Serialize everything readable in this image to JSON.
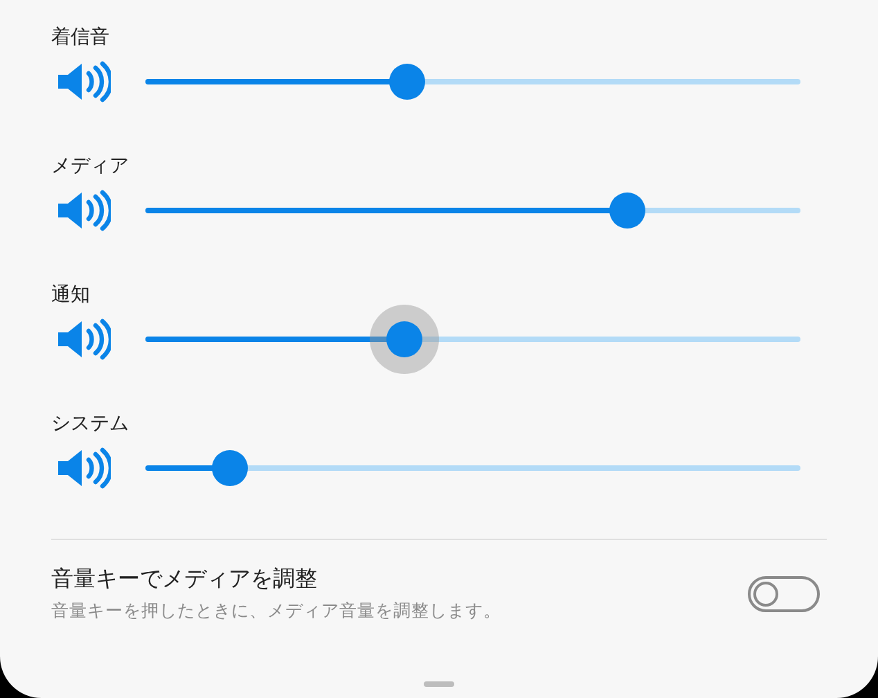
{
  "sliders": [
    {
      "label": "着信音",
      "level": 0.4,
      "pressed": false
    },
    {
      "label": "メディア",
      "level": 0.735,
      "pressed": false
    },
    {
      "label": "通知",
      "level": 0.395,
      "pressed": true
    },
    {
      "label": "システム",
      "level": 0.13,
      "pressed": false
    }
  ],
  "setting": {
    "title": "音量キーでメディアを調整",
    "description": "音量キーを押したときに、メディア音量を調整します。",
    "on": false
  }
}
